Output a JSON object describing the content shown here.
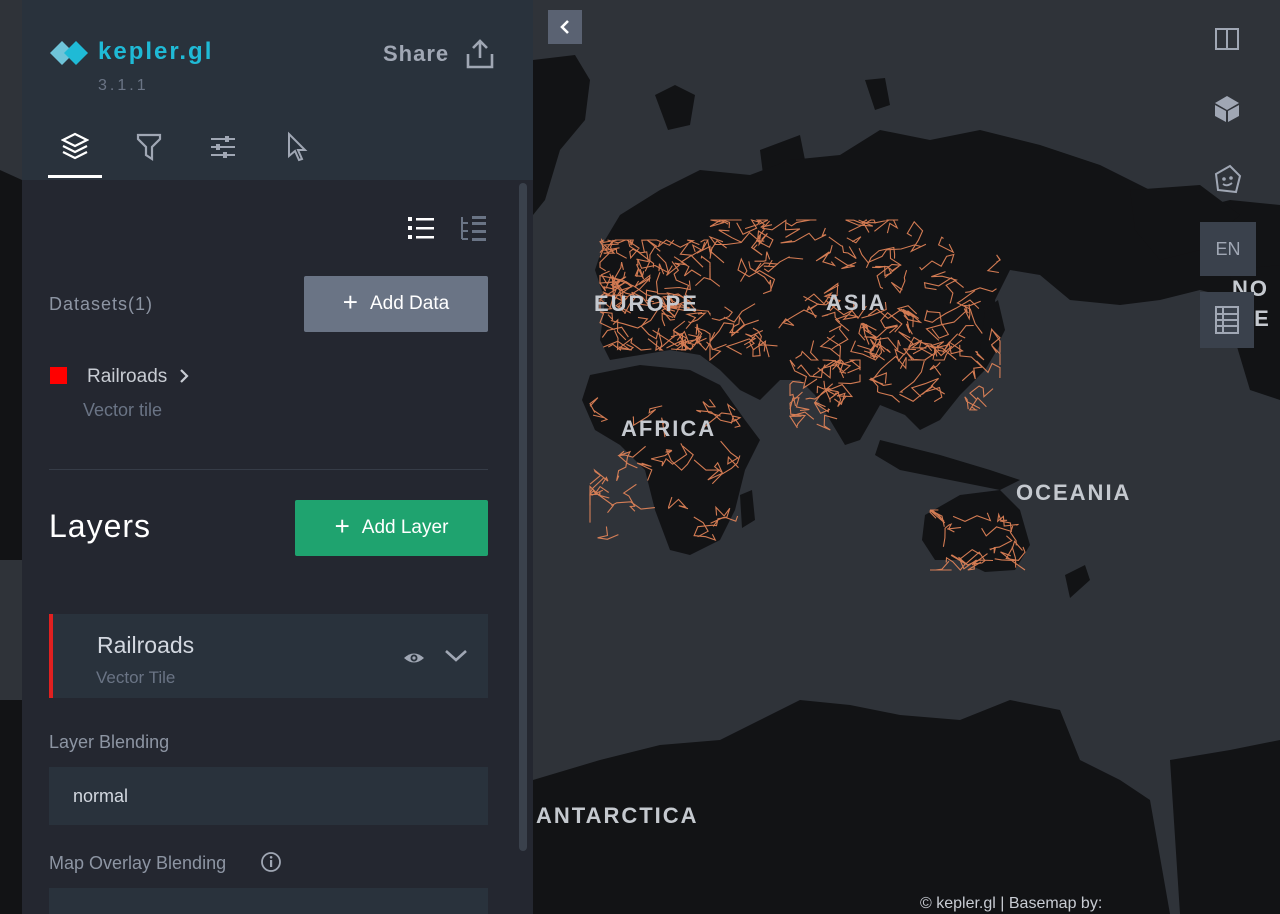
{
  "header": {
    "app_name": "kepler.gl",
    "version": "3.1.1",
    "share_label": "Share"
  },
  "tabs": [
    {
      "name": "layers",
      "icon": "layers-icon",
      "active": true
    },
    {
      "name": "filters",
      "icon": "filter-icon",
      "active": false
    },
    {
      "name": "interactions",
      "icon": "sliders-icon",
      "active": false
    },
    {
      "name": "base-map",
      "icon": "cursor-icon",
      "active": false
    }
  ],
  "datasets": {
    "title": "Datasets(1)",
    "add_label": "Add Data",
    "items": [
      {
        "name": "Railroads",
        "type": "Vector tile",
        "color": "#ff0000"
      }
    ]
  },
  "layers": {
    "title": "Layers",
    "add_label": "Add Layer",
    "items": [
      {
        "name": "Railroads",
        "type": "Vector Tile",
        "color": "#e02020"
      }
    ],
    "layer_blending_label": "Layer Blending",
    "layer_blending_value": "normal",
    "map_overlay_blending_label": "Map Overlay Blending"
  },
  "map": {
    "labels": [
      "EUROPE",
      "ASIA",
      "AFRICA",
      "OCEANIA",
      "ANTARCTICA",
      "NO",
      "IE"
    ],
    "language": "EN",
    "attribution": "© kepler.gl | Basemap by:",
    "rail_color": "#e8875a",
    "land_color": "#121315",
    "sea_color": "#2f3339"
  },
  "colors": {
    "accent": "#1fbad6",
    "add_layer": "#1fa36f",
    "panel": "#29323c"
  }
}
